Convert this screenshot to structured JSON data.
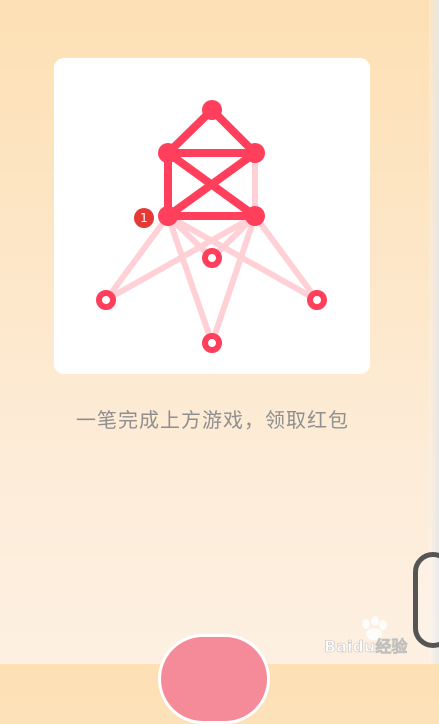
{
  "puzzle": {
    "badge_number": "1",
    "caption": "一笔完成上方游戏，领取红包",
    "colors": {
      "card_background": "#ffffff",
      "drawn_line": "#ff3f5c",
      "undrawn_line": "#ffd1d6",
      "badge": "#e53935",
      "caption_text": "#8f8f8f",
      "start_button": "#f58a98"
    }
  },
  "watermark": {
    "text": "Baidu经验",
    "icon": "paw-icon"
  }
}
